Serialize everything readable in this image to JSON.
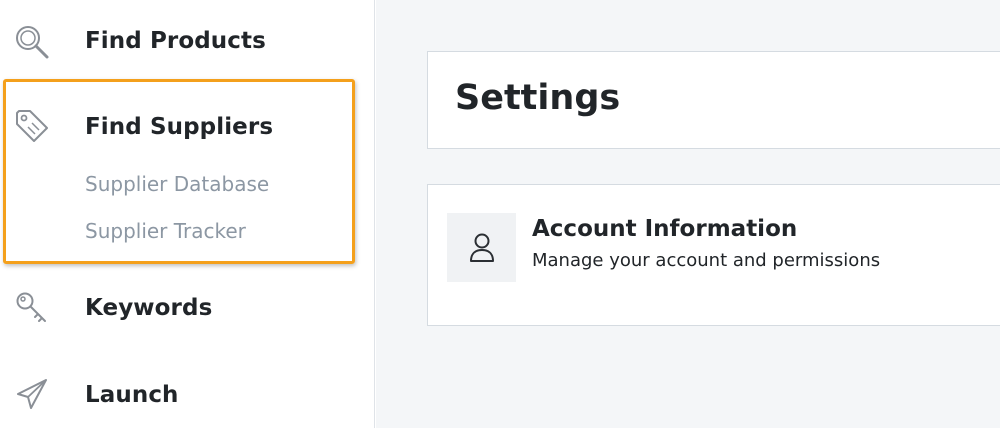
{
  "sidebar": {
    "items": [
      {
        "label": "Find Products",
        "icon": "search-icon"
      },
      {
        "label": "Find Suppliers",
        "icon": "tag-icon",
        "children": [
          {
            "label": "Supplier Database"
          },
          {
            "label": "Supplier Tracker"
          }
        ]
      },
      {
        "label": "Keywords",
        "icon": "key-icon"
      },
      {
        "label": "Launch",
        "icon": "paper-plane-icon"
      }
    ]
  },
  "main": {
    "title": "Settings",
    "cards": [
      {
        "title": "Account Information",
        "description": "Manage your account and permissions",
        "icon": "user-icon"
      }
    ]
  },
  "colors": {
    "highlight": "#f4a01c",
    "text_primary": "#212529",
    "text_muted": "#8c97a3",
    "main_bg": "#f4f6f8"
  }
}
